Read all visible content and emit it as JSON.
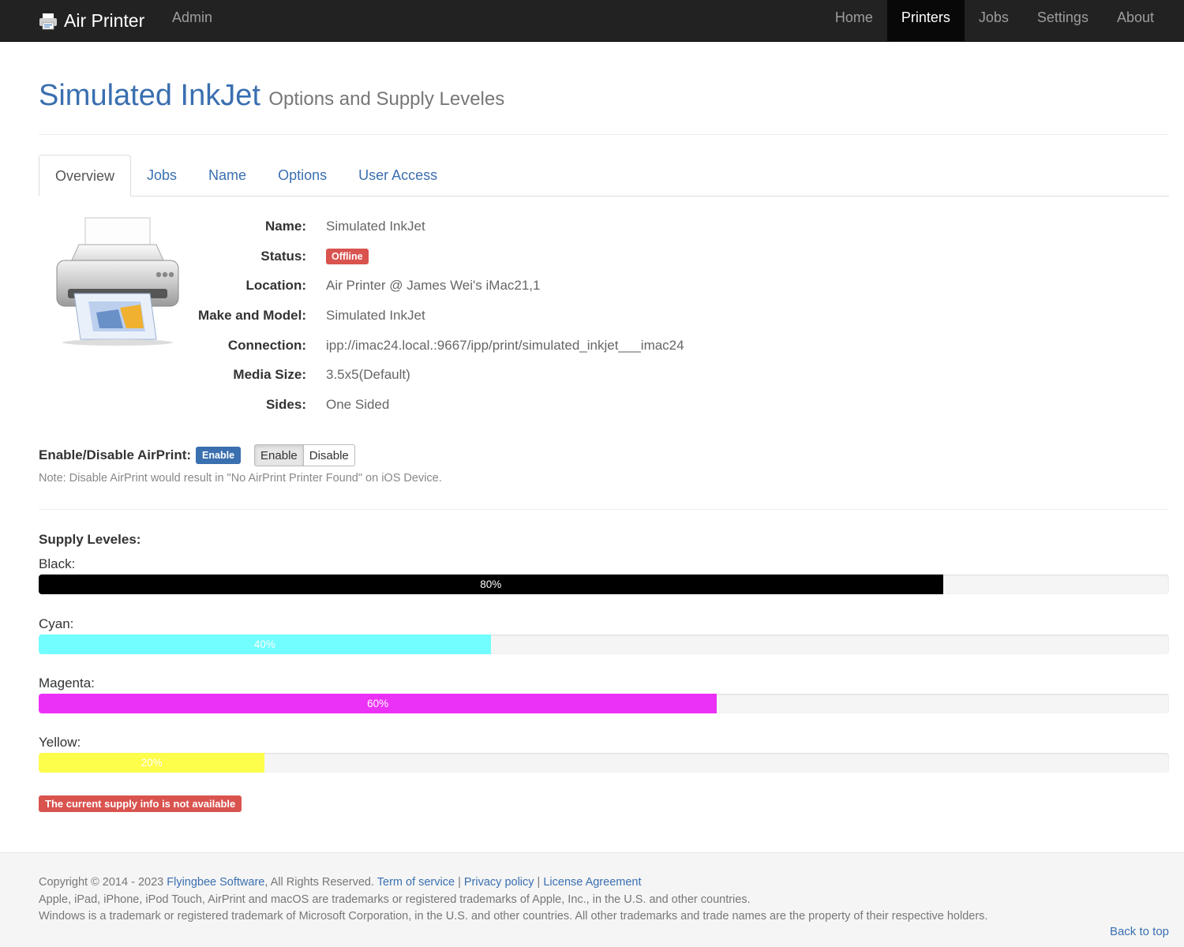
{
  "navbar": {
    "brand": "Air Printer",
    "admin": "Admin",
    "items": [
      {
        "label": "Home",
        "active": false
      },
      {
        "label": "Printers",
        "active": true
      },
      {
        "label": "Jobs",
        "active": false
      },
      {
        "label": "Settings",
        "active": false
      },
      {
        "label": "About",
        "active": false
      }
    ]
  },
  "header": {
    "title": "Simulated InkJet",
    "subtitle": "Options and Supply Leveles"
  },
  "tabs": [
    {
      "label": "Overview",
      "active": true
    },
    {
      "label": "Jobs",
      "active": false
    },
    {
      "label": "Name",
      "active": false
    },
    {
      "label": "Options",
      "active": false
    },
    {
      "label": "User Access",
      "active": false
    }
  ],
  "details": {
    "name_label": "Name:",
    "name": "Simulated InkJet",
    "status_label": "Status:",
    "status": "Offline",
    "location_label": "Location:",
    "location": "Air Printer @ James Wei's iMac21,1",
    "model_label": "Make and Model:",
    "model": "Simulated InkJet",
    "connection_label": "Connection:",
    "connection": "ipp://imac24.local.:9667/ipp/print/simulated_inkjet___imac24",
    "media_label": "Media Size:",
    "media": "3.5x5(Default)",
    "sides_label": "Sides:",
    "sides": "One Sided"
  },
  "airprint": {
    "label": "Enable/Disable AirPrint:",
    "state": "Enable",
    "enable_button": "Enable",
    "disable_button": "Disable",
    "note": "Note: Disable AirPrint would result in \"No AirPrint Printer Found\" on iOS Device."
  },
  "supply": {
    "title": "Supply Leveles:",
    "levels": [
      {
        "name": "Black:",
        "percent": 80,
        "percent_label": "80%",
        "color": "#000000"
      },
      {
        "name": "Cyan:",
        "percent": 40,
        "percent_label": "40%",
        "color": "#72fdfe"
      },
      {
        "name": "Magenta:",
        "percent": 60,
        "percent_label": "60%",
        "color": "#ec31f6"
      },
      {
        "name": "Yellow:",
        "percent": 20,
        "percent_label": "20%",
        "color": "#fdfd4b"
      }
    ],
    "warning": "The current supply info is not available"
  },
  "footer": {
    "copyright_prefix": "Copyright © 2014 - 2023 ",
    "company": "Flyingbee Software",
    "rights": ", All Rights Reserved. ",
    "terms": "Term of service",
    "sep": " | ",
    "privacy": "Privacy policy",
    "license": "License Agreement",
    "line2": "Apple, iPad, iPhone, iPod Touch, AirPrint and macOS are trademarks or registered trademarks of Apple, Inc., in the U.S. and other countries.",
    "line3": "Windows is a trademark or registered trademark of Microsoft Corporation, in the U.S. and other countries. All other trademarks and trade names are the property of their respective holders.",
    "back_to_top": "Back to top"
  },
  "colors": {
    "navbar": "#222222",
    "link": "#3a6fb0",
    "danger": "#d9534f"
  }
}
